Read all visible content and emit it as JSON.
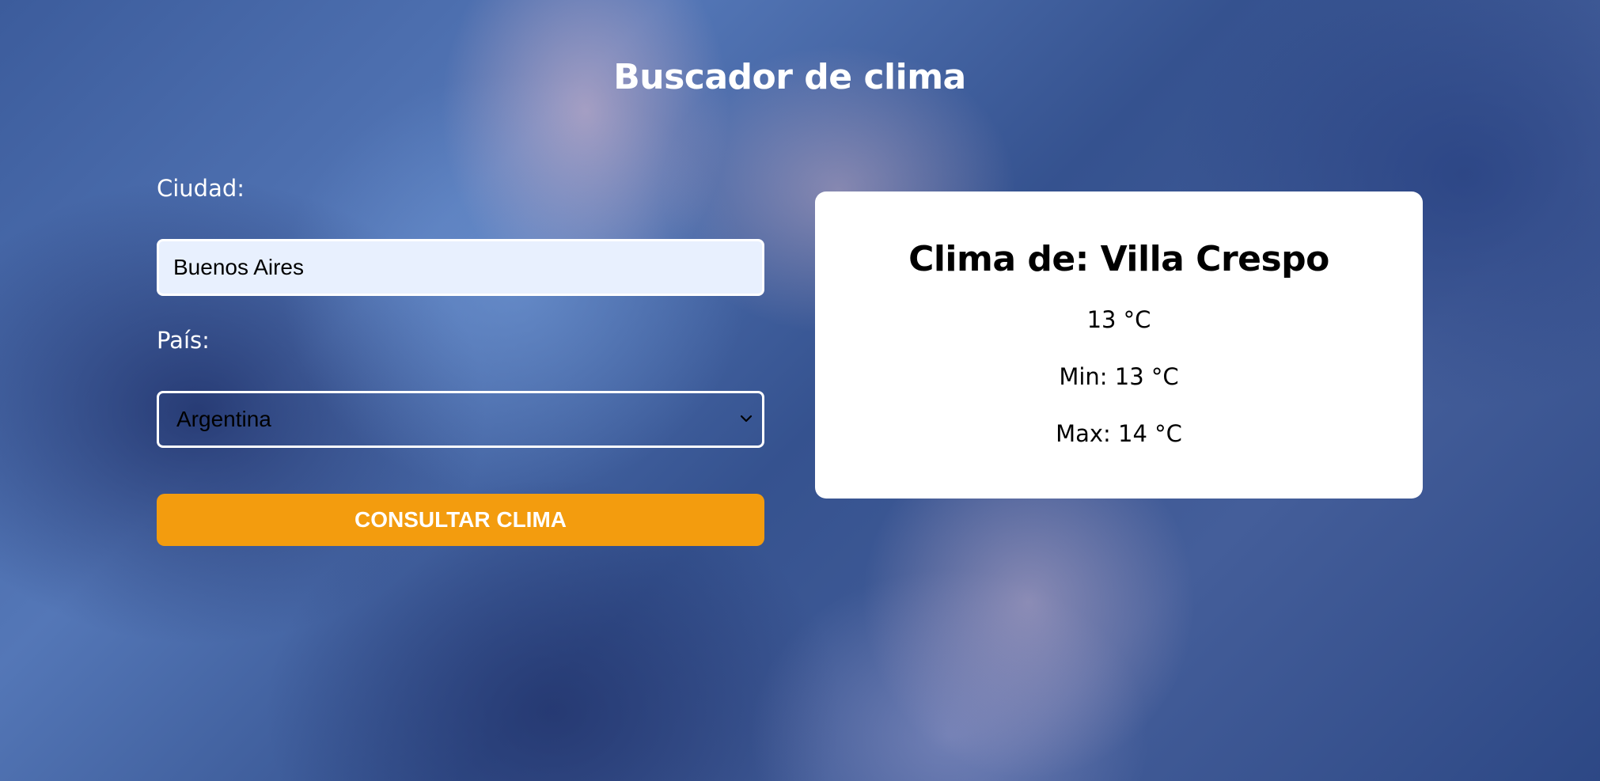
{
  "header": {
    "title": "Buscador de clima"
  },
  "form": {
    "city_label": "Ciudad:",
    "city_value": "Buenos Aires",
    "country_label": "País:",
    "country_selected": "Argentina",
    "submit_label": "CONSULTAR CLIMA"
  },
  "result": {
    "title": "Clima de: Villa Crespo",
    "temperature": "13 °C",
    "min": "Min: 13 °C",
    "max": "Max: 14 °C"
  },
  "colors": {
    "accent_button": "#f39c0e",
    "input_background": "#e8f0fe",
    "card_background": "#ffffff"
  },
  "icons": {
    "select_arrow": "chevron-down-icon"
  }
}
